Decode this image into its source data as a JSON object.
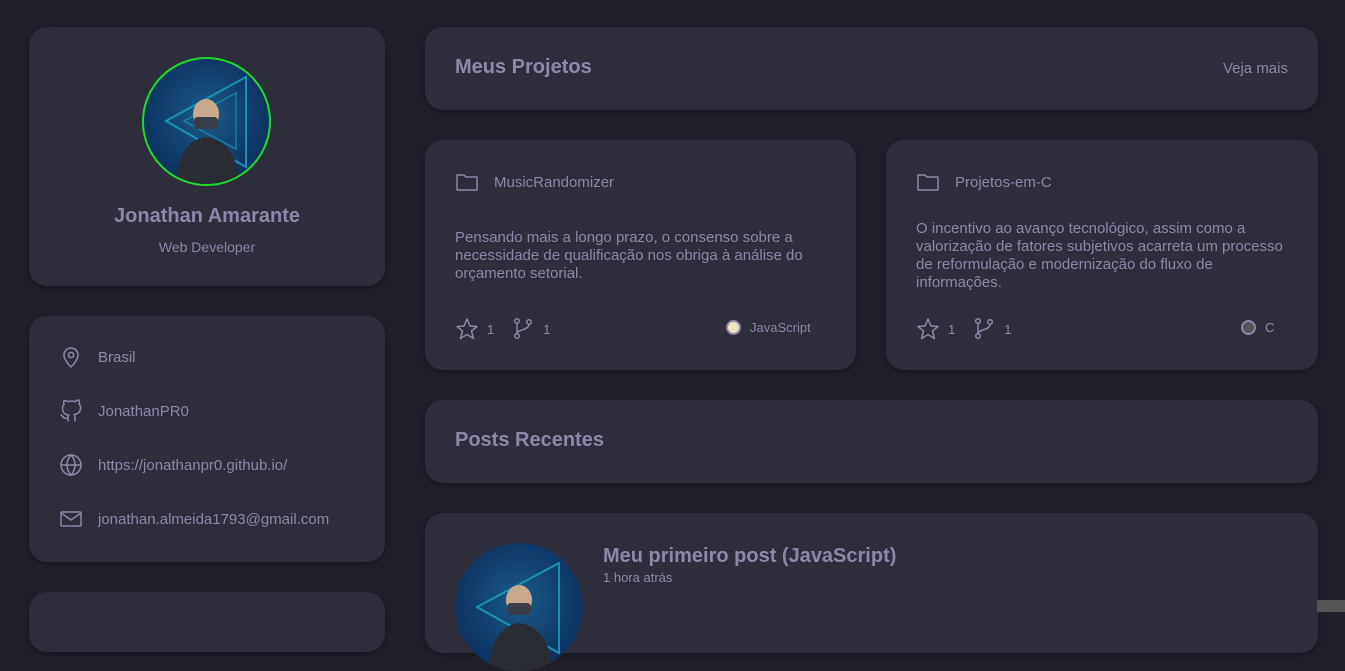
{
  "profile": {
    "name": "Jonathan Amarante",
    "role": "Web Developer"
  },
  "info": {
    "location": "Brasil",
    "github": "JonathanPR0",
    "website": "https://jonathanpr0.github.io/",
    "email": "jonathan.almeida1793@gmail.com"
  },
  "projects_section": {
    "title": "Meus Projetos",
    "more_label": "Veja mais"
  },
  "projects": [
    {
      "name": "MusicRandomizer",
      "description": "Pensando mais a longo prazo, o consenso sobre a necessidade de qualificação nos obriga à análise do orçamento setorial.",
      "stars": "1",
      "forks": "1",
      "language": "JavaScript",
      "language_color": "#f1e5c0"
    },
    {
      "name": "Projetos-em-C",
      "description": "O incentivo ao avanço tecnológico, assim como a valorização de fatores subjetivos acarreta um processo de reformulação e modernização do fluxo de informações.",
      "stars": "1",
      "forks": "1",
      "language": "C",
      "language_color": "#555555"
    }
  ],
  "posts_section": {
    "title": "Posts Recentes"
  },
  "post": {
    "title": "Meu primeiro post (JavaScript)",
    "time": "1 hora atrás"
  },
  "colors": {
    "background": "#21202a",
    "card": "#2e2d3b",
    "text": "#8e87aa",
    "avatar_ring": "#1ddc2a"
  }
}
